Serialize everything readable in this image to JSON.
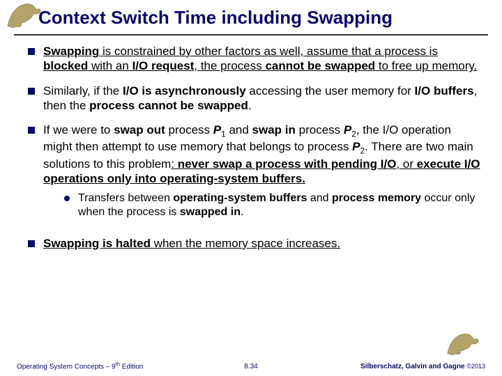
{
  "title": "Context Switch Time including Swapping",
  "bullets": {
    "b1": {
      "p1": "Swapping",
      "p2": " is constrained by other factors as well, assume that a process is ",
      "p3": "blocked",
      "p4": " with an ",
      "p5": "I/O request",
      "p6": ", the process ",
      "p7": "cannot be swapped",
      "p8": " to free up memory."
    },
    "b2": {
      "p1": "Similarly, if the ",
      "p2": "I/O is asynchronously",
      "p3": " accessing the user memory for ",
      "p4": "I/O buffers",
      "p5": ", then the ",
      "p6": "process cannot be swapped",
      "p7": "."
    },
    "b3": {
      "p1": "If we were to ",
      "p2": "swap out",
      "p3": " process ",
      "p4": "P",
      "s4": "1",
      "p5": " and ",
      "p6": "swap in",
      "p7": " process ",
      "p8": "P",
      "s8": "2",
      "p9": ", the I/O operation might then attempt to use memory that belongs to process ",
      "p10": "P",
      "s10": "2",
      "p11": ". There are two main solutions to this problem",
      "p12": ": ",
      "p13": "never swap a process with pending I/O",
      "p14": ", or ",
      "p15": "execute I/O operations only into operating-system buffers."
    },
    "b3s": {
      "p1": "Transfers between ",
      "p2": "operating-system buffers",
      "p3": " and ",
      "p4": "process memory",
      "p5": " occur only when the process is ",
      "p6": "swapped in",
      "p7": "."
    },
    "b4": {
      "p1": "Swapping is halted",
      "p2": " when the memory space increases."
    }
  },
  "footer": {
    "left_a": "Operating System Concepts – 9",
    "left_sup": "th",
    "left_b": " Edition",
    "center": "8.34",
    "right_a": "Silberschatz, Galvin and Gagne ",
    "right_b": "©2013"
  }
}
